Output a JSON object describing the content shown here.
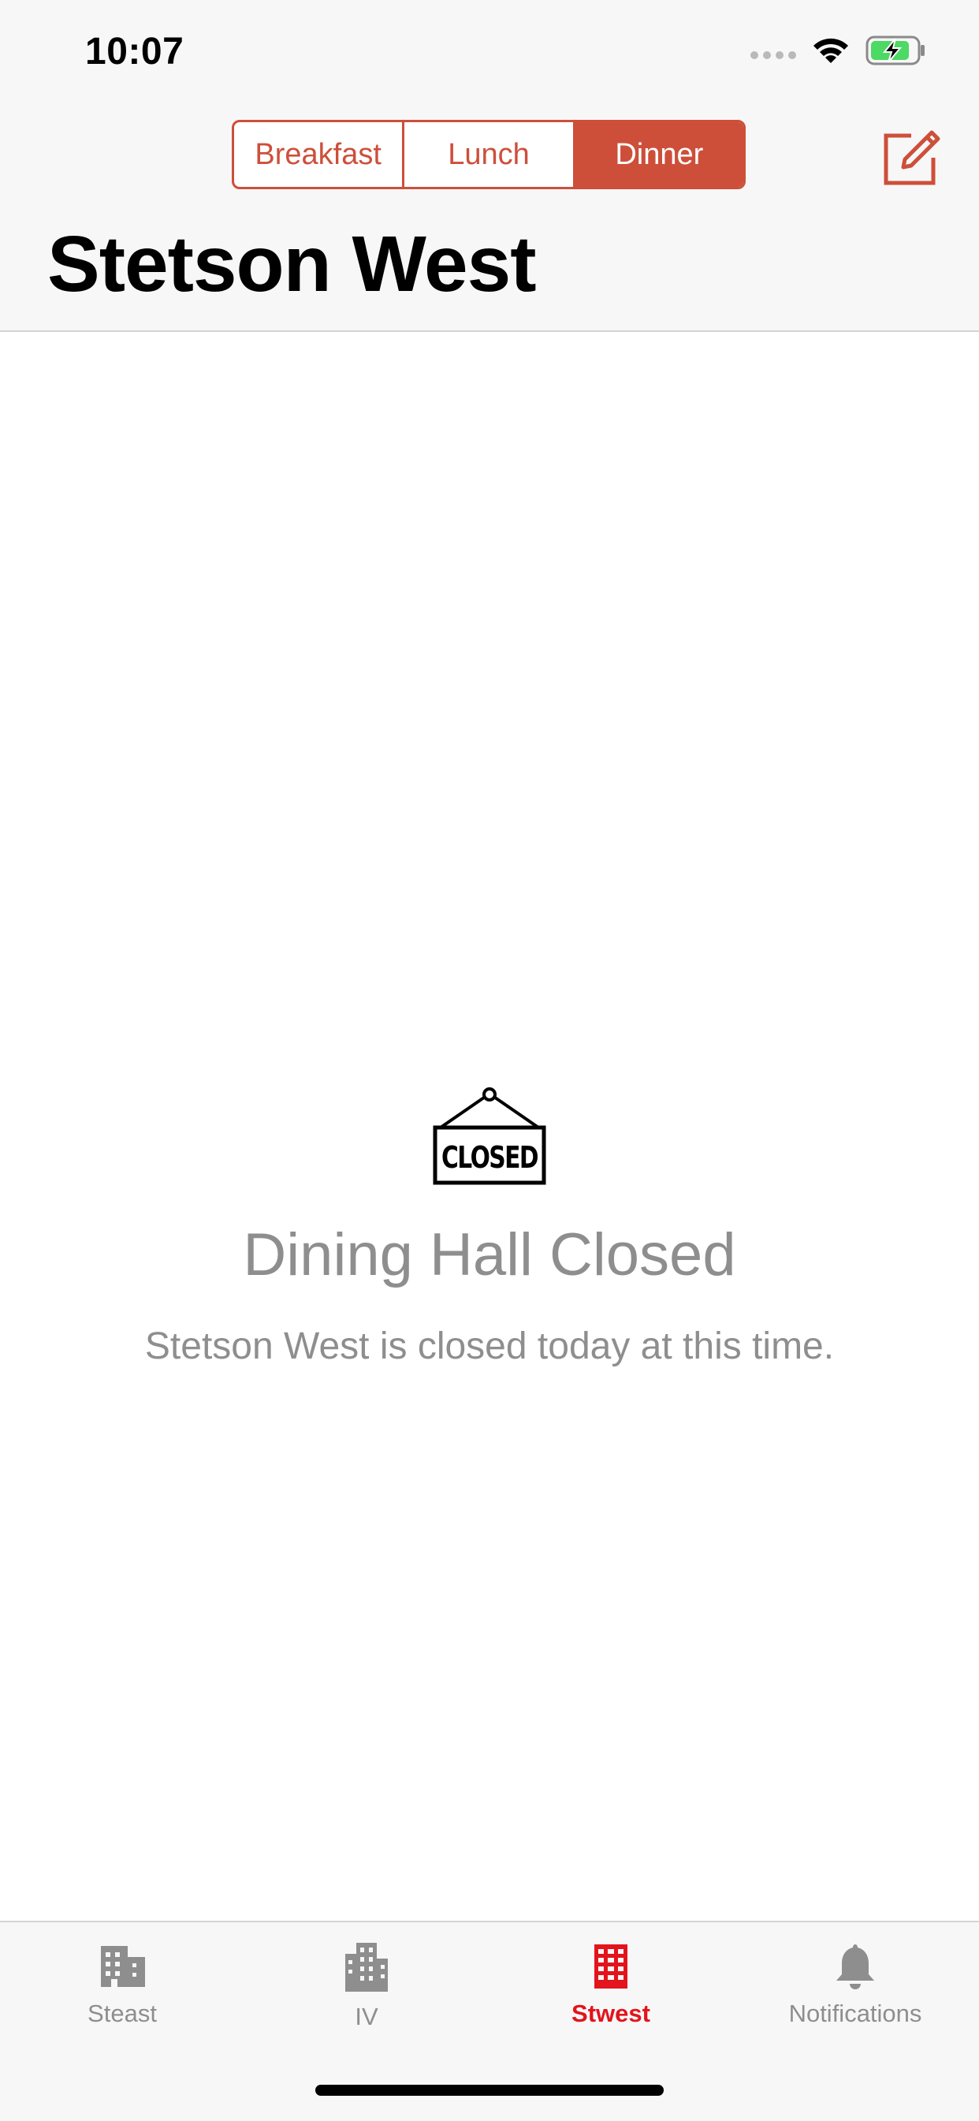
{
  "status": {
    "time": "10:07"
  },
  "header": {
    "segments": [
      "Breakfast",
      "Lunch",
      "Dinner"
    ],
    "selected_segment": "Dinner",
    "title": "Stetson West"
  },
  "empty_state": {
    "icon": "closed-sign-icon",
    "sign_text": "CLOSED",
    "title": "Dining Hall Closed",
    "subtitle": "Stetson West is closed today at this time."
  },
  "tabs": [
    {
      "label": "Steast",
      "icon": "building-icon",
      "active": false
    },
    {
      "label": "IV",
      "icon": "tall-building-icon",
      "active": false
    },
    {
      "label": "Stwest",
      "icon": "grid-building-icon",
      "active": true
    },
    {
      "label": "Notifications",
      "icon": "bell-icon",
      "active": false
    }
  ],
  "colors": {
    "accent": "#cd4f3a",
    "tab_active": "#e3141b",
    "muted": "#8e8e8e"
  }
}
